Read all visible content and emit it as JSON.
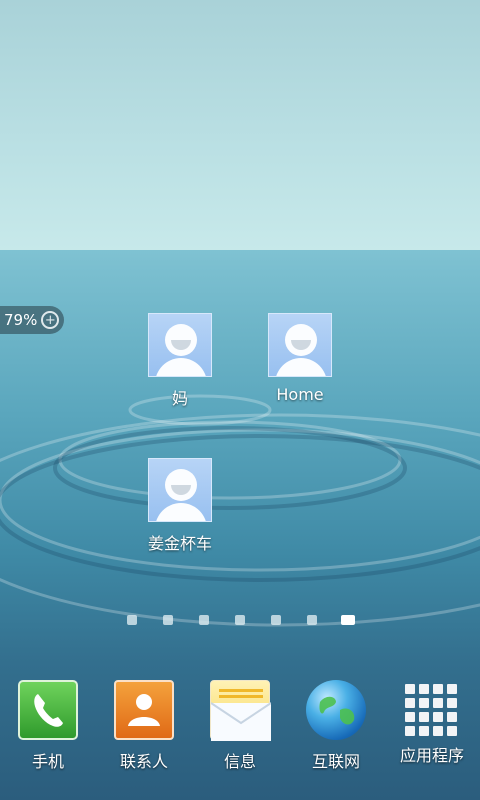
{
  "status": {
    "battery_percent": "79%",
    "battery_icon": "charging-plus-icon"
  },
  "shortcuts": [
    {
      "label": "妈"
    },
    {
      "label": "Home"
    },
    {
      "label": "姜金杯车"
    }
  ],
  "pager": {
    "pages": 7,
    "active_index": 6
  },
  "dock": [
    {
      "label": "手机",
      "icon": "phone-icon"
    },
    {
      "label": "联系人",
      "icon": "contacts-icon"
    },
    {
      "label": "信息",
      "icon": "message-icon"
    },
    {
      "label": "互联网",
      "icon": "globe-icon"
    },
    {
      "label": "应用程序",
      "icon": "apps-grid-icon"
    }
  ]
}
